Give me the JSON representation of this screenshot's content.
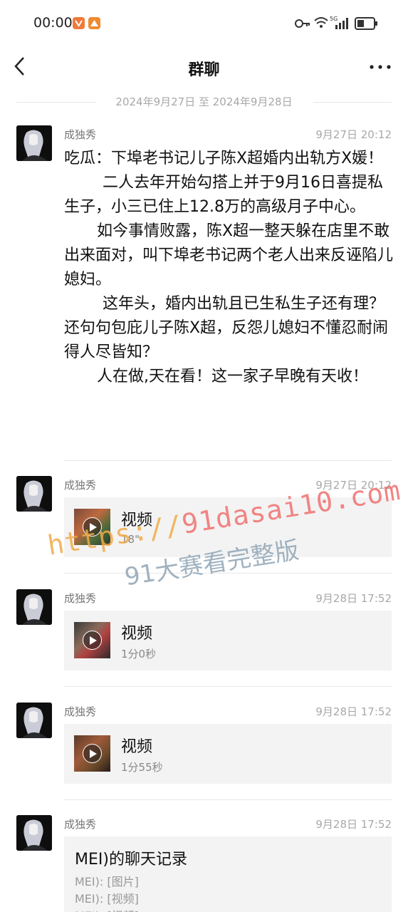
{
  "status_bar": {
    "time": "00:00",
    "network": "5G"
  },
  "nav": {
    "title": "群聊"
  },
  "date_range": "2024年9月27日 至 2024年9月28日",
  "messages": [
    {
      "sender": "成独秀",
      "time": "9月27日 20:12",
      "paragraphs": [
        "吃瓜：下埠老书记儿子陈X超婚内出轨方X媛！",
        "二人去年开始勾搭上并于9月16日喜提私生子，小三已住上12.8万的高级月子中心。",
        "如今事情败露，陈X超一整天躲在店里不敢出来面对，叫下埠老书记两个老人出来反诬陷儿媳妇。",
        "这年头，婚内出轨且已生私生子还有理？还句句包庇儿子陈X超，反怨儿媳妇不懂忍耐闹得人尽皆知？",
        "人在做,天在看！这一家子早晚有天收！"
      ]
    },
    {
      "sender": "成独秀",
      "time": "9月27日 20:12",
      "video_title": "视频",
      "video_duration": "18\""
    },
    {
      "sender": "成独秀",
      "time": "9月28日 17:52",
      "video_title": "视频",
      "video_duration": "1分0秒"
    },
    {
      "sender": "成独秀",
      "time": "9月28日 17:52",
      "video_title": "视频",
      "video_duration": "1分55秒"
    },
    {
      "sender": "成独秀",
      "time": "9月28日 17:52",
      "record_title": "MEI)的聊天记录",
      "record_lines": [
        "MEI): [图片]",
        "MEI): [视频]",
        "MEI): [视频]"
      ]
    }
  ],
  "watermark": {
    "url_part1": "https://",
    "url_part2": "91dasai10.com",
    "subtitle": "91大赛看完整版"
  },
  "colors": {
    "secondary_text": "#a8a8a8",
    "card_bg": "#f3f3f3"
  }
}
